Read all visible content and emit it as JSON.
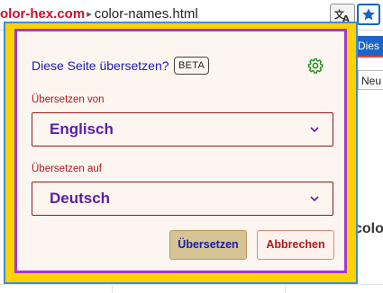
{
  "address_bar": {
    "host": "olor-hex.com",
    "path": "color-names.html",
    "translate_icon": "translate-icon",
    "bookmark_icon": "star-icon"
  },
  "page": {
    "right_strip_text": "Dies",
    "right_table_text": "Neu",
    "right_heading_text": "colo"
  },
  "translate_popup": {
    "title": "Diese Seite übersetzen?",
    "badge": "BETA",
    "settings_icon": "gear-icon",
    "from_label": "Übersetzen von",
    "from_value": "Englisch",
    "to_label": "Übersetzen auf",
    "to_value": "Deutsch",
    "translate_button": "Übersetzen",
    "cancel_button": "Abbrechen"
  },
  "colors": {
    "popup_border": "#3a8fd6",
    "popup_frame": "#ffd200",
    "inner_border": "#a339c7",
    "label_red": "#b0171f",
    "value_purple": "#5a1ea6",
    "accent_blue": "#1565c0"
  }
}
